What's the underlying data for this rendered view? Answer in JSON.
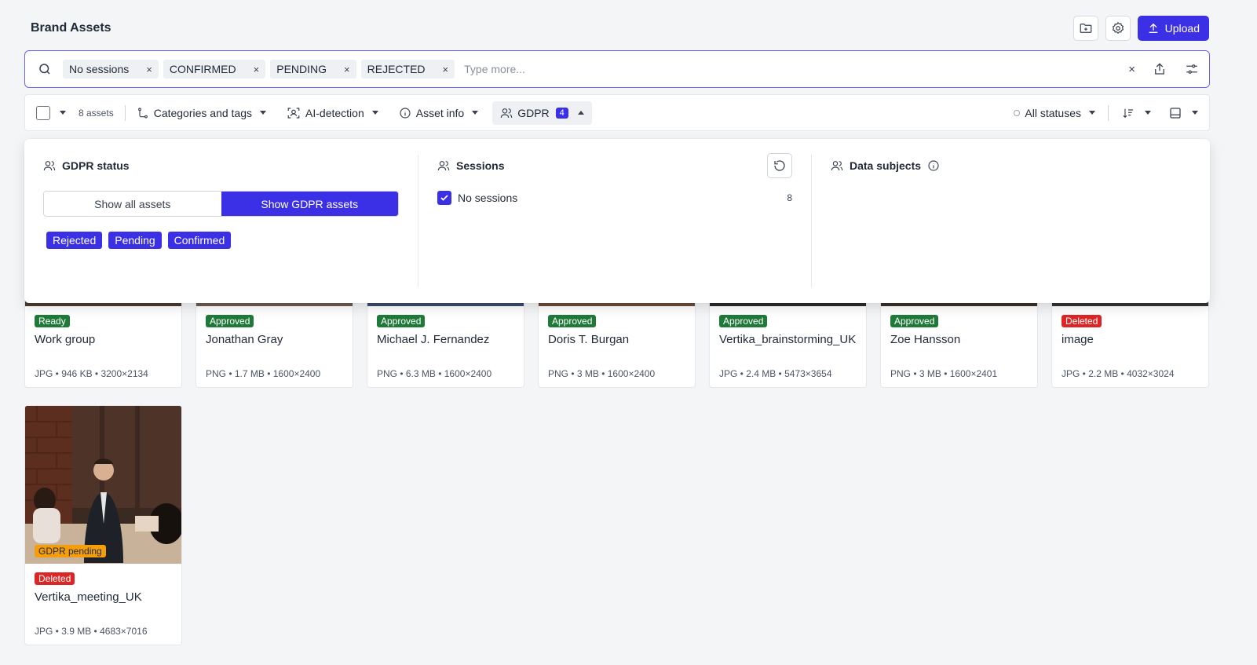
{
  "header": {
    "title": "Brand Assets",
    "upload_label": "Upload"
  },
  "search": {
    "chips": [
      "No sessions",
      "CONFIRMED",
      "PENDING",
      "REJECTED"
    ],
    "placeholder": "Type more...",
    "clear_symbol": "×"
  },
  "toolbar": {
    "asset_count": "8 assets",
    "categories_label": "Categories and tags",
    "ai_label": "AI-detection",
    "asset_info_label": "Asset info",
    "gdpr_label": "GDPR",
    "gdpr_count": "4",
    "statuses_label": "All statuses"
  },
  "gdpr_panel": {
    "status_title": "GDPR status",
    "show_all_label": "Show all assets",
    "show_gdpr_label": "Show GDPR assets",
    "status_tags": [
      "Rejected",
      "Pending",
      "Confirmed"
    ],
    "sessions_title": "Sessions",
    "session_option": "No sessions",
    "session_count": "8",
    "data_subjects_title": "Data subjects"
  },
  "assets": [
    {
      "status": "Ready",
      "name": "Work group",
      "meta": "JPG • 946 KB • 3200×2134"
    },
    {
      "status": "Approved",
      "name": "Jonathan Gray",
      "meta": "PNG • 1.7 MB • 1600×2400"
    },
    {
      "status": "Approved",
      "name": "Michael J. Fernandez",
      "meta": "PNG • 6.3 MB • 1600×2400"
    },
    {
      "status": "Approved",
      "name": "Doris T. Burgan",
      "meta": "PNG • 3 MB • 1600×2400"
    },
    {
      "status": "Approved",
      "name": "Vertika_brainstorming_UK",
      "meta": "JPG • 2.4 MB • 5473×3654"
    },
    {
      "status": "Approved",
      "name": "Zoe Hansson",
      "meta": "PNG • 3 MB • 1600×2401"
    },
    {
      "status": "Deleted",
      "name": "image",
      "meta": "JPG • 2.2 MB • 4032×3024"
    },
    {
      "status": "Deleted",
      "name": "Vertika_meeting_UK",
      "meta": "JPG • 3.9 MB • 4683×7016",
      "overlay": "GDPR pending"
    }
  ]
}
